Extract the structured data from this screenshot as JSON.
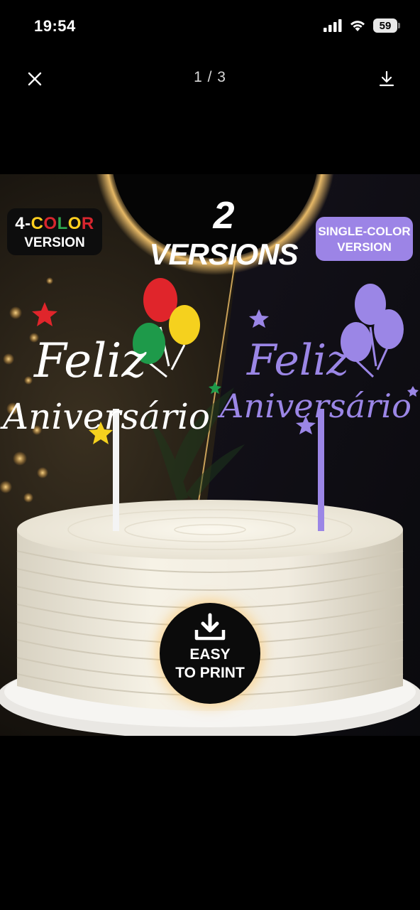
{
  "status_bar": {
    "time": "19:54",
    "battery": "59"
  },
  "viewer": {
    "counter": "1 / 3"
  },
  "image": {
    "headline_number": "2",
    "headline_text": "VERSIONS",
    "left_badge": {
      "line1_parts": [
        "4-",
        "C",
        "O",
        "L",
        "O",
        "R"
      ],
      "line2": "VERSION"
    },
    "left_badge_colors": [
      "#ffffff",
      "#ffcf1f",
      "#d8262e",
      "#2fa84f",
      "#ffcf1f",
      "#d8262e"
    ],
    "right_badge": {
      "line1": "SINGLE-COLOR",
      "line2": "VERSION"
    },
    "topper_line1": "Feliz",
    "topper_line2": "Aniversário",
    "print_badge": {
      "line1": "EASY",
      "line2": "TO PRINT"
    },
    "colors": {
      "white_topper": "#ffffff",
      "purple_topper": "#9b86e6",
      "red": "#e0252b",
      "yellow": "#f5d11e",
      "green": "#1e9a4a"
    }
  },
  "icons": [
    "close-icon",
    "download-icon",
    "signal-icon",
    "wifi-icon",
    "battery-icon",
    "print-download-icon",
    "star-icon",
    "balloon-icon"
  ]
}
